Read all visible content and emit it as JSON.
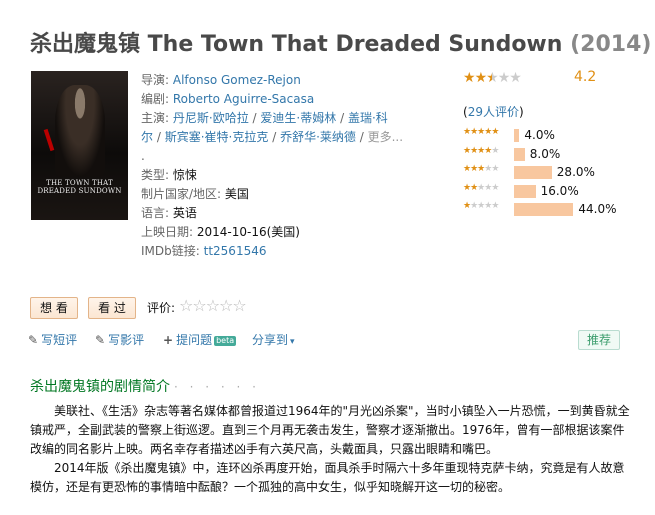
{
  "title": {
    "name": "杀出魔鬼镇 The Town That Dreaded Sundown",
    "year": "(2014)"
  },
  "poster": {
    "text": "THE TOWN THAT DREADED SUNDOWN"
  },
  "info": {
    "director_label": "导演:",
    "director": "Alfonso Gomez-Rejon",
    "writer_label": "编剧:",
    "writer": "Roberto Aguirre-Sacasa",
    "cast_label": "主演:",
    "cast_line1": [
      "丹尼斯·欧哈拉",
      "爱迪生·蒂姆林",
      "盖瑞·科"
    ],
    "cast_line2": [
      "尔",
      "斯宾塞·崔特·克拉克",
      "乔舒华·莱纳德",
      "更多..."
    ],
    "cast_line3": ".",
    "genre_label": "类型:",
    "genre": "惊悚",
    "country_label": "制片国家/地区:",
    "country": "美国",
    "language_label": "语言:",
    "language": "英语",
    "release_label": "上映日期:",
    "release": "2014-10-16(美国)",
    "imdb_label": "IMDb链接:",
    "imdb": "tt2561546"
  },
  "rating": {
    "score": "4.2",
    "stars": 2.5,
    "votes": "29人评价",
    "distribution": [
      {
        "stars": 5,
        "percent": "4.0%",
        "value": 4.0
      },
      {
        "stars": 4,
        "percent": "8.0%",
        "value": 8.0
      },
      {
        "stars": 3,
        "percent": "28.0%",
        "value": 28.0
      },
      {
        "stars": 2,
        "percent": "16.0%",
        "value": 16.0
      },
      {
        "stars": 1,
        "percent": "44.0%",
        "value": 44.0
      }
    ]
  },
  "buttons": {
    "want": "想 看",
    "seen": "看 过",
    "rate_label": "评价:"
  },
  "actions": {
    "short_review": "写短评",
    "review": "写影评",
    "question": "提问题",
    "beta": "beta",
    "share": "分享到",
    "recommend": "推荐"
  },
  "summary": {
    "heading": "杀出魔鬼镇的剧情简介",
    "heading_dots": "· · · · · ·",
    "p1": "美联社、《生活》杂志等著名媒体都曾报道过1964年的\"月光凶杀案\"，当时小镇坠入一片恐慌，一到黄昏就全镇戒严，全副武装的警察上街巡逻。直到三个月再无袭击发生，警察才逐渐撤出。1976年，曾有一部根据该案件改编的同名影片上映。两名幸存者描述凶手有六英尺高，头戴面具，只露出眼睛和嘴巴。",
    "p2": "2014年版《杀出魔鬼镇》中，连环凶杀再度开始，面具杀手时隔六十多年重现特克萨卡纳，究竟是有人故意模仿，还是有更恐怖的事情暗中酝酿？一个孤独的高中女生，似乎知晓解开这一切的秘密。"
  },
  "colors": {
    "star": "#e09015",
    "bar": "#f8c79f",
    "link": "#3377aa",
    "heading_green": "#007722"
  }
}
